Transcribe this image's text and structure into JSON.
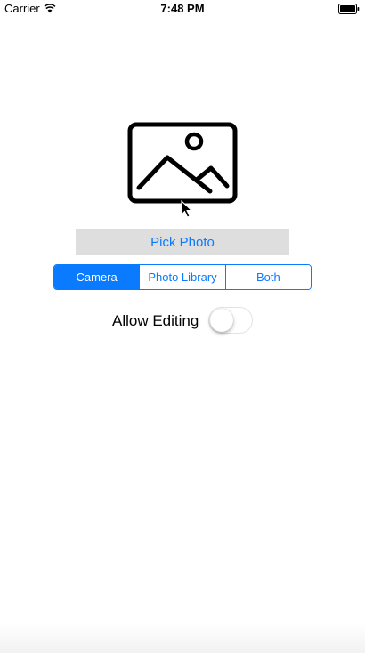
{
  "status_bar": {
    "carrier": "Carrier",
    "time": "7:48 PM",
    "wifi_icon": "wifi-icon",
    "battery_icon": "battery-icon"
  },
  "main": {
    "image_icon": "photo-placeholder-icon",
    "pick_button_label": "Pick Photo",
    "segments": [
      {
        "label": "Camera",
        "selected": true
      },
      {
        "label": "Photo Library",
        "selected": false
      },
      {
        "label": "Both",
        "selected": false
      }
    ],
    "allow_editing_label": "Allow Editing",
    "allow_editing_on": false
  },
  "colors": {
    "accent": "#0a7aff",
    "button_bg": "#dedede"
  }
}
